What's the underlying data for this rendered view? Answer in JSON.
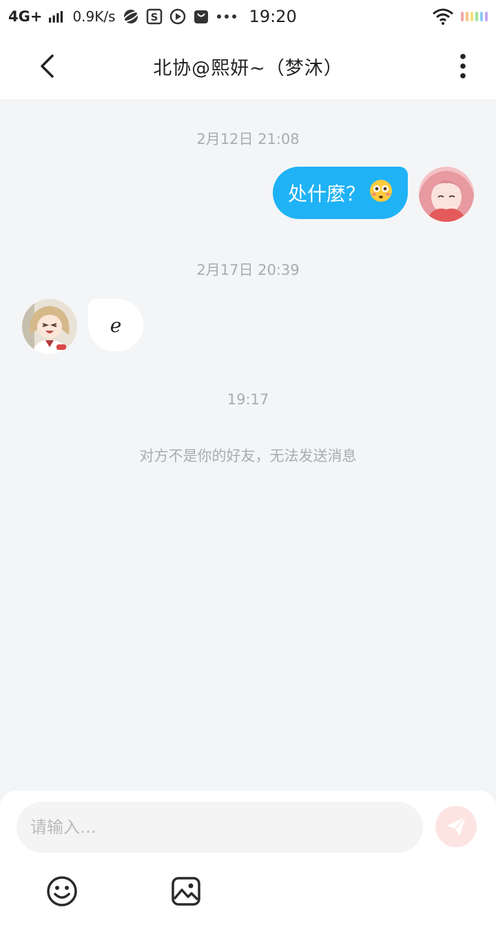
{
  "status_bar": {
    "network": "4G+",
    "speed": "0.9K/s",
    "time": "19:20",
    "icons": [
      "signal-icon",
      "browser-icon",
      "s-app-icon",
      "play-icon",
      "bag-icon",
      "more-dots-icon",
      "wifi-icon",
      "battery-icon"
    ]
  },
  "header": {
    "title": "北协@熙妍~（梦沐）",
    "back_icon": "chevron-left-icon",
    "more_icon": "more-vertical-icon"
  },
  "messages": [
    {
      "timestamp": "2月12日 21:08",
      "direction": "outgoing",
      "text": "处什麼？",
      "emoji": "flushed-face-emoji"
    },
    {
      "timestamp": "2月17日 20:39",
      "direction": "incoming",
      "text": "e"
    },
    {
      "timestamp": "19:17"
    }
  ],
  "notice": "对方不是你的好友，无法发送消息",
  "composer": {
    "placeholder": "请输入…",
    "send_icon": "paper-plane-icon",
    "tools": [
      "emoji-icon",
      "image-icon"
    ]
  },
  "colors": {
    "accent": "#1fb2f5",
    "background": "#f4f5f7",
    "send_button": "#fde4e2",
    "muted_text": "#a9abb0"
  }
}
